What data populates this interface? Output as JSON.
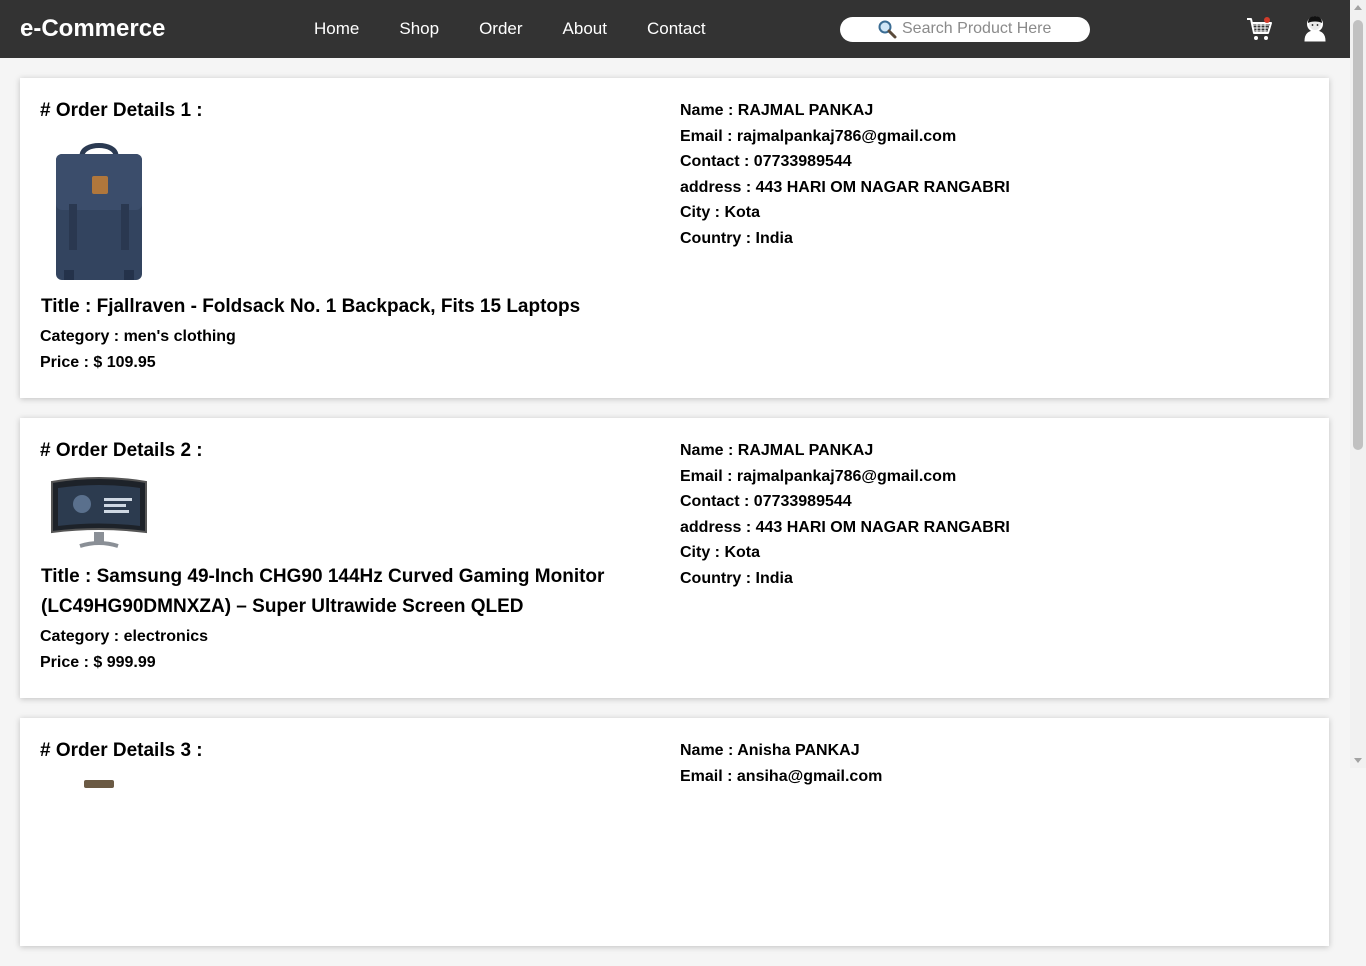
{
  "brand": "e-Commerce",
  "nav": {
    "home": "Home",
    "shop": "Shop",
    "order": "Order",
    "about": "About",
    "contact": "Contact"
  },
  "search": {
    "placeholder": "Search Product Here",
    "icon": "search-icon"
  },
  "header_icons": {
    "cart": "cart-icon",
    "user": "user-icon"
  },
  "orders": [
    {
      "heading": "# Order Details 1 :",
      "image": "backpack",
      "title": "Title : Fjallraven - Foldsack No. 1 Backpack, Fits 15 Laptops",
      "category": "Category : men's clothing",
      "price": "Price : $ 109.95",
      "name": "Name : RAJMAL PANKAJ",
      "email": "Email : rajmalpankaj786@gmail.com",
      "contact": "Contact : 07733989544",
      "address": "address : 443 HARI OM NAGAR RANGABRI",
      "city": "City : Kota",
      "country": "Country : India"
    },
    {
      "heading": "# Order Details 2 :",
      "image": "curved-monitor",
      "title": "Title : Samsung 49-Inch CHG90 144Hz Curved Gaming Monitor (LC49HG90DMNXZA) – Super Ultrawide Screen QLED",
      "category": "Category : electronics",
      "price": "Price : $ 999.99",
      "name": "Name : RAJMAL PANKAJ",
      "email": "Email : rajmalpankaj786@gmail.com",
      "contact": "Contact : 07733989544",
      "address": "address : 443 HARI OM NAGAR RANGABRI",
      "city": "City : Kota",
      "country": "Country : India"
    },
    {
      "heading": "# Order Details 3 :",
      "name": "Name : Anisha PANKAJ",
      "email": "Email : ansiha@gmail.com"
    }
  ],
  "colors": {
    "navbar": "#333333",
    "page_bg": "#f5f5f5",
    "card_bg": "#ffffff",
    "text": "#000000"
  }
}
